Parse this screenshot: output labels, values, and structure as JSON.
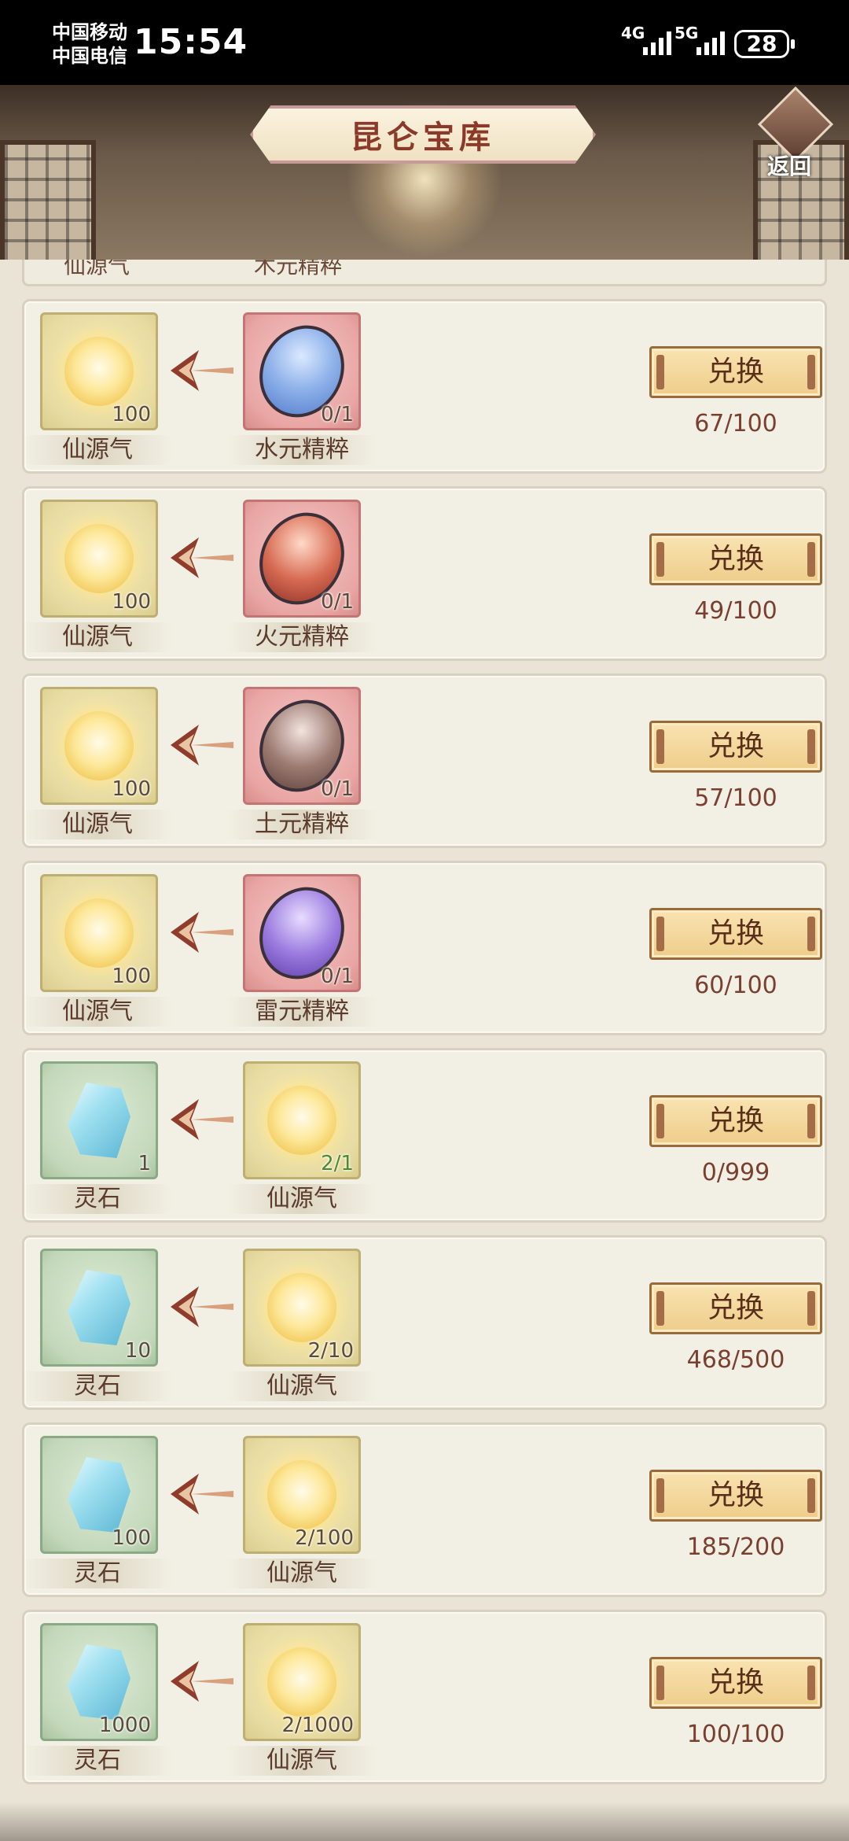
{
  "status_bar": {
    "carrier1": "中国移动",
    "carrier2": "中国电信",
    "time": "15:54",
    "net1": "4G",
    "net2": "5G",
    "battery": "28"
  },
  "header": {
    "title": "昆仑宝库",
    "back_label": "返回"
  },
  "partial_row": {
    "left_name": "仙源气",
    "right_name": "木元精粹"
  },
  "exchange_label": "兑换",
  "rows": [
    {
      "target": {
        "name": "仙源气",
        "count": "100",
        "kind": "orb"
      },
      "cost": {
        "name": "水元精粹",
        "count": "0/1",
        "kind": "gem-blue"
      },
      "limit": "67/100"
    },
    {
      "target": {
        "name": "仙源气",
        "count": "100",
        "kind": "orb"
      },
      "cost": {
        "name": "火元精粹",
        "count": "0/1",
        "kind": "gem-red"
      },
      "limit": "49/100"
    },
    {
      "target": {
        "name": "仙源气",
        "count": "100",
        "kind": "orb"
      },
      "cost": {
        "name": "土元精粹",
        "count": "0/1",
        "kind": "gem-brown"
      },
      "limit": "57/100"
    },
    {
      "target": {
        "name": "仙源气",
        "count": "100",
        "kind": "orb"
      },
      "cost": {
        "name": "雷元精粹",
        "count": "0/1",
        "kind": "gem-purple"
      },
      "limit": "60/100"
    },
    {
      "target": {
        "name": "灵石",
        "count": "1",
        "kind": "stone"
      },
      "cost": {
        "name": "仙源气",
        "count": "2/1",
        "kind": "orb"
      },
      "limit": "0/999"
    },
    {
      "target": {
        "name": "灵石",
        "count": "10",
        "kind": "stone"
      },
      "cost": {
        "name": "仙源气",
        "count": "2/10",
        "kind": "orb"
      },
      "limit": "468/500"
    },
    {
      "target": {
        "name": "灵石",
        "count": "100",
        "kind": "stone"
      },
      "cost": {
        "name": "仙源气",
        "count": "2/100",
        "kind": "orb"
      },
      "limit": "185/200"
    },
    {
      "target": {
        "name": "灵石",
        "count": "1000",
        "kind": "stone"
      },
      "cost": {
        "name": "仙源气",
        "count": "2/1000",
        "kind": "orb"
      },
      "limit": "100/100"
    }
  ]
}
